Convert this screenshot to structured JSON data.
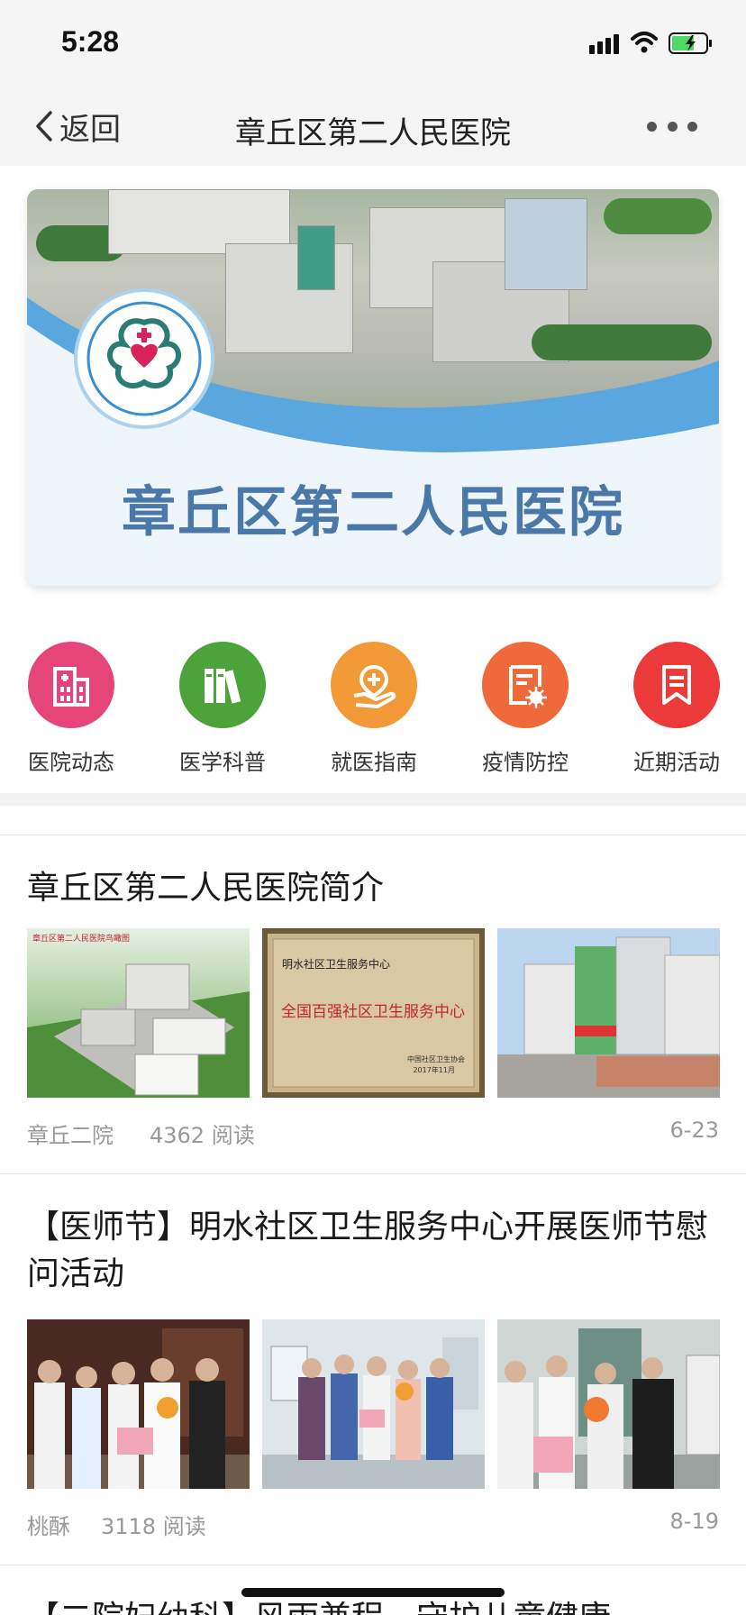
{
  "status_bar": {
    "time": "5:28"
  },
  "nav": {
    "back_label": "返回",
    "title": "章丘区第二人民医院"
  },
  "banner": {
    "title": "章丘区第二人民医院"
  },
  "quick_menu": [
    {
      "label": "医院动态",
      "color": "#e6457a",
      "icon": "hospital-building-icon"
    },
    {
      "label": "医学科普",
      "color": "#4ba33a",
      "icon": "books-icon"
    },
    {
      "label": "就医指南",
      "color": "#f29a38",
      "icon": "hand-medical-icon"
    },
    {
      "label": "疫情防控",
      "color": "#ee6a3a",
      "icon": "virus-document-icon"
    },
    {
      "label": "近期活动",
      "color": "#ec3a3a",
      "icon": "bookmark-icon"
    }
  ],
  "articles": [
    {
      "title": "章丘区第二人民医院简介",
      "author": "章丘二院",
      "reads": "4362 阅读",
      "date": "6-23",
      "thumb_texts": {
        "plan_caption": "章丘区第二人民医院鸟瞰图",
        "plaque_org": "明水社区卫生服务中心",
        "plaque_title": "全国百强社区卫生服务中心",
        "plaque_issuer": "中国社区卫生协会",
        "plaque_date": "2017年11月"
      }
    },
    {
      "title": "【医师节】明水社区卫生服务中心开展医师节慰问活动",
      "author": "桃酥",
      "reads": "3118 阅读",
      "date": "8-19"
    },
    {
      "title": "【二院妇幼科】风雨兼程，守护儿童健康"
    }
  ]
}
